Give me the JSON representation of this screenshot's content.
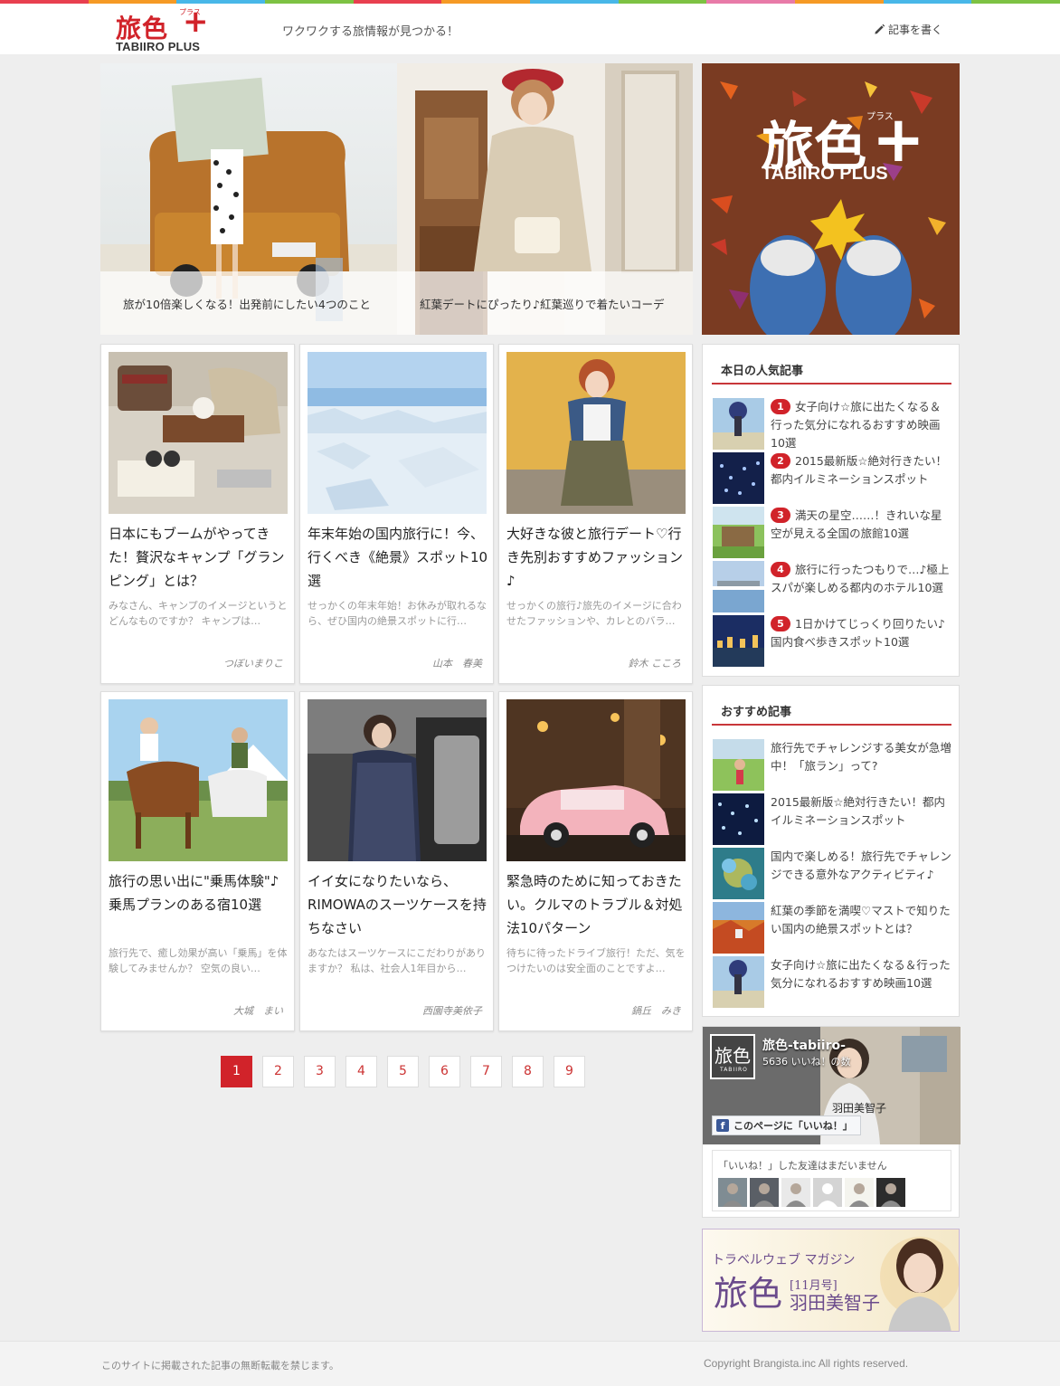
{
  "colors": {
    "brand_red": "#d1232a",
    "topbar": [
      "#e83f4f",
      "#f59a25",
      "#48b7e8",
      "#7dc243",
      "#e83f4f",
      "#f59a25",
      "#48b7e8",
      "#7dc243",
      "#e87aa8",
      "#f59a25",
      "#48b7e8",
      "#7dc243"
    ]
  },
  "header": {
    "logo_kanji": "旅色",
    "logo_plus": "+",
    "logo_ruby": "プラス",
    "logo_roman": "TABIIRO PLUS",
    "tagline": "ワクワクする旅情報が見つかる！",
    "write_label": "記事を書く",
    "write_icon": "pencil-icon"
  },
  "hero": [
    {
      "caption": "旅が10倍楽しくなる！出発前にしたい4つのこと"
    },
    {
      "caption": "紅葉デートにぴったり♪紅葉巡りで着たいコーデ"
    }
  ],
  "side_banner": {
    "kanji": "旅色",
    "plus": "+",
    "ruby": "プラス",
    "roman": "TABIIRO PLUS"
  },
  "articles": [
    {
      "title": "日本にもブームがやってきた！贅沢なキャンプ「グランピング」とは？",
      "excerpt": "みなさん、キャンプのイメージというとどんなものですか？ キャンプは…",
      "author": "つぼいまりこ"
    },
    {
      "title": "年末年始の国内旅行に！今、行くべき《絶景》スポット10選",
      "excerpt": "せっかくの年末年始！お休みが取れるなら、ぜひ国内の絶景スポットに行…",
      "author": "山本　春美"
    },
    {
      "title": "大好きな彼と旅行デート♡行き先別おすすめファッション♪",
      "excerpt": "せっかくの旅行♪旅先のイメージに合わせたファッションや、カレとのバラ…",
      "author": "鈴木 こころ"
    },
    {
      "title": "旅行の思い出に\"乗馬体験\"♪乗馬プランのある宿10選",
      "excerpt": "旅行先で、癒し効果が高い「乗馬」を体験してみませんか？ 空気の良い…",
      "author": "大城　まい"
    },
    {
      "title": "イイ女になりたいなら、RIMOWAのスーツケースを持ちなさい",
      "excerpt": "あなたはスーツケースにこだわりがありますか？ 私は、社会人1年目から…",
      "author": "西園寺美依子"
    },
    {
      "title": "緊急時のために知っておきたい。クルマのトラブル＆対処法10パターン",
      "excerpt": "待ちに待ったドライブ旅行！ただ、気をつけたいのは安全面のことですよ…",
      "author": "鍋丘　みき"
    }
  ],
  "pagination": [
    "1",
    "2",
    "3",
    "4",
    "5",
    "6",
    "7",
    "8",
    "9"
  ],
  "popular": {
    "title": "本日の人気記事",
    "items": [
      {
        "rank": "1",
        "text": "女子向け☆旅に出たくなる＆行った気分になれるおすすめ映画10選"
      },
      {
        "rank": "2",
        "text": "2015最新版☆絶対行きたい！都内イルミネーションスポット"
      },
      {
        "rank": "3",
        "text": "満天の星空……！きれいな星空が見える全国の旅館10選"
      },
      {
        "rank": "4",
        "text": "旅行に行ったつもりで…♪極上スパが楽しめる都内のホテル10選"
      },
      {
        "rank": "5",
        "text": "1日かけてじっくり回りたい♪国内食べ歩きスポット10選"
      }
    ]
  },
  "recommended": {
    "title": "おすすめ記事",
    "items": [
      {
        "text": "旅行先でチャレンジする美女が急増中！「旅ラン」って?"
      },
      {
        "text": "2015最新版☆絶対行きたい！都内イルミネーションスポット"
      },
      {
        "text": "国内で楽しめる！旅行先でチャレンジできる意外なアクティビティ♪"
      },
      {
        "text": "紅葉の季節を満喫♡マストで知りたい国内の絶景スポットとは？"
      },
      {
        "text": "女子向け☆旅に出たくなる＆行った気分になれるおすすめ映画10選"
      }
    ]
  },
  "facebook": {
    "page_name": "旅色-tabiiro-",
    "likes": "5636 いいね！の数",
    "like_button": "このページに「いいね！」",
    "friends_text": "「いいね！」した友達はまだいません",
    "logo_kanji": "旅色",
    "logo_roman": "TABIIRO",
    "cover_text": "羽田美智子"
  },
  "ad": {
    "line1": "トラベルウェブ マガジン",
    "kanji": "旅色",
    "issue": "[11月号]",
    "name": "羽田美智子"
  },
  "footer": {
    "left": "このサイトに掲載された記事の無断転載を禁じます。",
    "right": "Copyright Brangista.inc All rights reserved."
  }
}
